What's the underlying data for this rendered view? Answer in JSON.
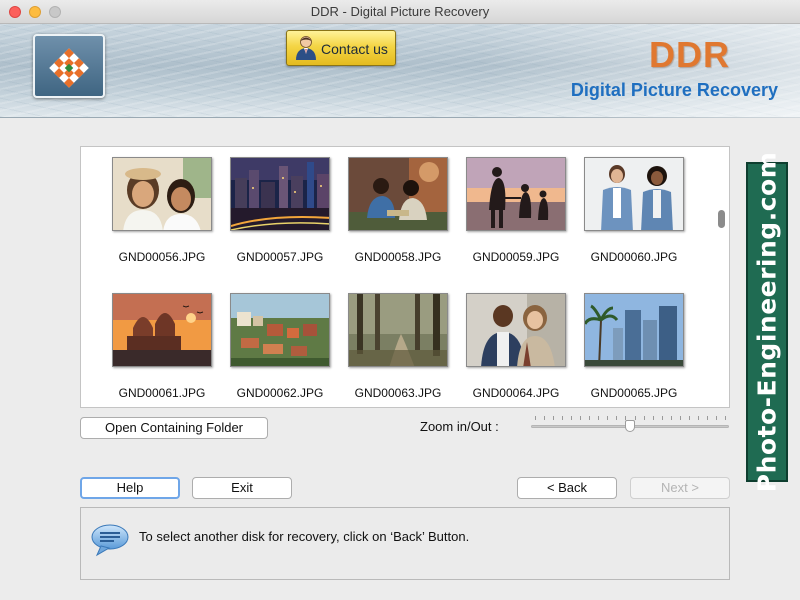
{
  "window": {
    "title": "DDR - Digital Picture Recovery"
  },
  "header": {
    "contact_label": "Contact us",
    "brand": "DDR",
    "subtitle": "Digital Picture Recovery",
    "brand_color": "#e07830",
    "subtitle_color": "#1f6fc0"
  },
  "gallery": {
    "files": [
      {
        "name": "GND00056.JPG",
        "scene": "two-women-selfie"
      },
      {
        "name": "GND00057.JPG",
        "scene": "city-night"
      },
      {
        "name": "GND00058.JPG",
        "scene": "couple-picnic"
      },
      {
        "name": "GND00059.JPG",
        "scene": "sunset-family-silhouette"
      },
      {
        "name": "GND00060.JPG",
        "scene": "two-women-denim"
      },
      {
        "name": "GND00061.JPG",
        "scene": "palace-sunset"
      },
      {
        "name": "GND00062.JPG",
        "scene": "old-town-landscape"
      },
      {
        "name": "GND00063.JPG",
        "scene": "forest-path"
      },
      {
        "name": "GND00064.JPG",
        "scene": "smiling-couple"
      },
      {
        "name": "GND00065.JPG",
        "scene": "skyscrapers-palms"
      }
    ]
  },
  "controls": {
    "open_folder": "Open Containing Folder",
    "zoom_label": "Zoom in/Out :",
    "zoom_level": 0.5,
    "help": "Help",
    "exit": "Exit",
    "back": "< Back",
    "next": "Next >"
  },
  "status": {
    "message": "To select another disk for recovery, click on ‘Back’ Button.",
    "icon": "speech-bubble-icon"
  },
  "watermark": {
    "text": "Photo-Engineering.com",
    "color": "#1f6b52"
  }
}
